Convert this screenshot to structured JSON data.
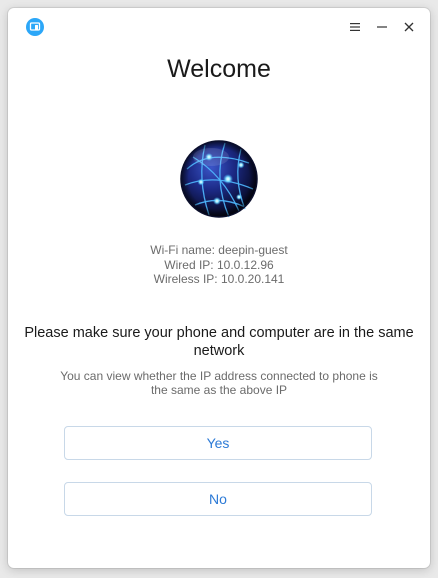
{
  "window": {
    "app_icon": "phone-assistant-icon",
    "controls": {
      "menu_icon": "hamburger-menu-icon",
      "minimize_icon": "minimize-icon",
      "close_icon": "close-icon"
    }
  },
  "main": {
    "title": "Welcome",
    "network_icon": "network-globe-icon",
    "network_info": {
      "wifi": "Wi-Fi name: deepin-guest",
      "wired": "Wired IP: 10.0.12.96",
      "wireless": "Wireless IP: 10.0.20.141"
    },
    "headline": "Please make sure your phone and computer are in the same network",
    "hint": "You can view whether the IP address connected to phone is the same as the above IP",
    "yes_label": "Yes",
    "no_label": "No"
  },
  "colors": {
    "accent": "#2c7ad6",
    "app_icon_bg": "#2ca7f8"
  }
}
